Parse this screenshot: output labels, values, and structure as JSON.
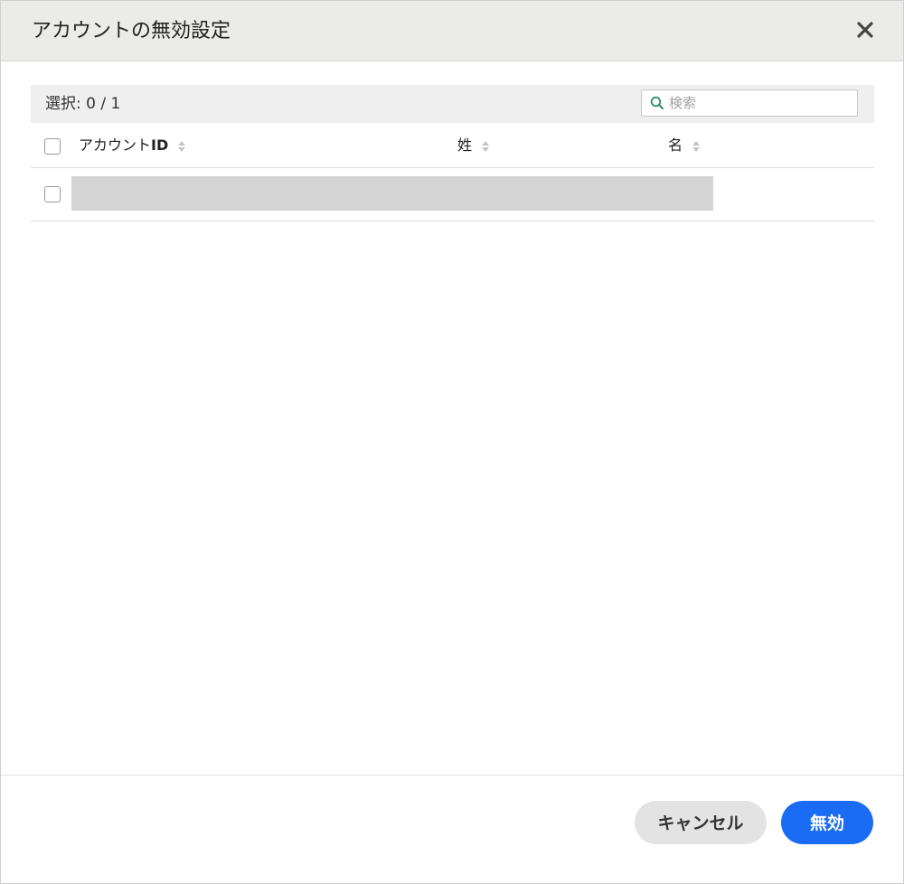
{
  "dialog": {
    "title": "アカウントの無効設定",
    "close_icon": "close-icon"
  },
  "toolbar": {
    "selection_label": "選択: 0 / 1",
    "search": {
      "placeholder": "検索",
      "value": "",
      "icon": "search-icon"
    }
  },
  "table": {
    "columns": [
      {
        "label": "アカウント",
        "label_suffix": "ID",
        "sort_icon": "sort-icon"
      },
      {
        "label": "姓",
        "sort_icon": "sort-icon"
      },
      {
        "label": "名",
        "sort_icon": "sort-icon"
      }
    ],
    "rows": [
      {
        "checked": false,
        "redacted": true
      }
    ]
  },
  "footer": {
    "cancel_label": "キャンセル",
    "disable_label": "無効"
  },
  "colors": {
    "header_bg": "#ebecea",
    "toolbar_bg": "#efefef",
    "primary": "#1a6cf5",
    "secondary_btn": "#e3e3e3",
    "search_icon": "#2e8b6e",
    "redacted": "#d4d4d4"
  }
}
